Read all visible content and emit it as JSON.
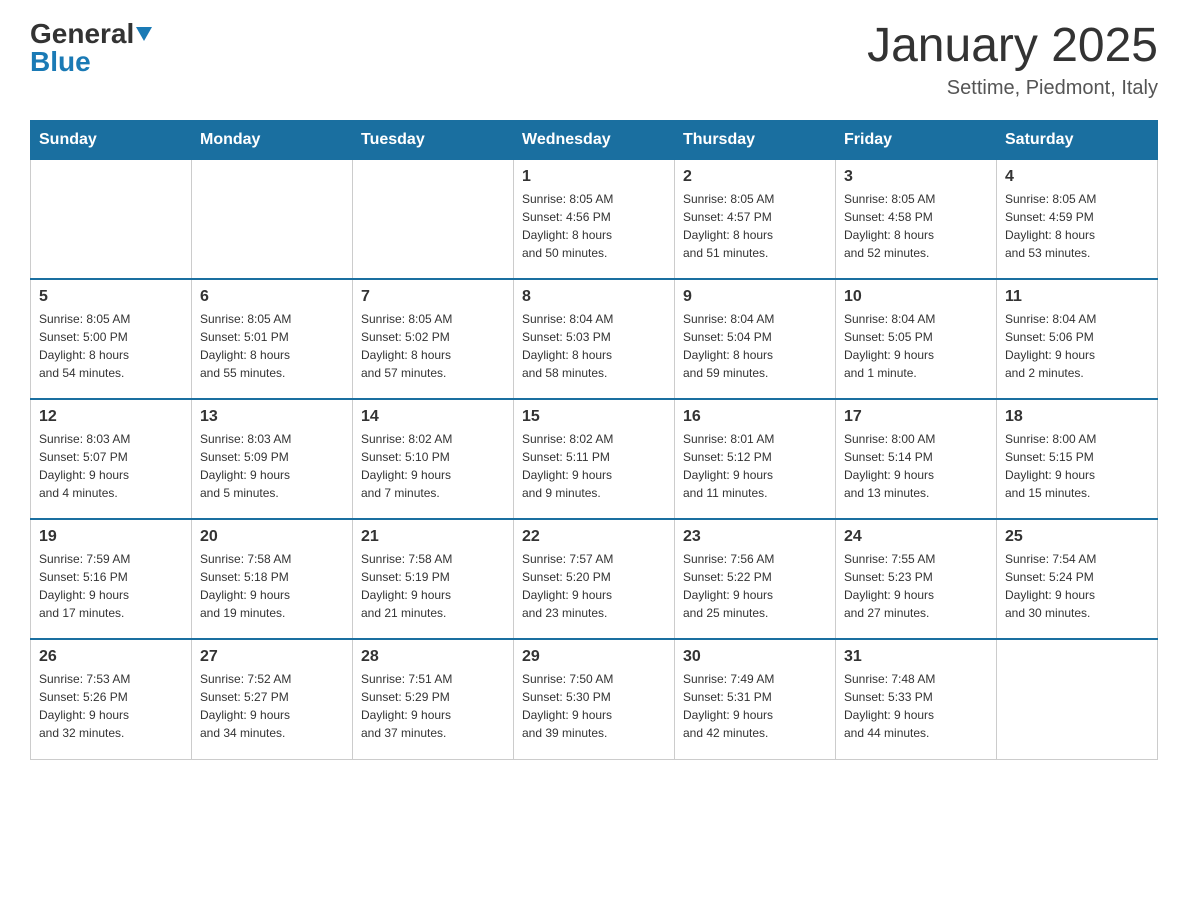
{
  "logo": {
    "general": "General",
    "blue": "Blue"
  },
  "title": "January 2025",
  "subtitle": "Settime, Piedmont, Italy",
  "weekdays": [
    "Sunday",
    "Monday",
    "Tuesday",
    "Wednesday",
    "Thursday",
    "Friday",
    "Saturday"
  ],
  "weeks": [
    [
      {
        "day": "",
        "info": ""
      },
      {
        "day": "",
        "info": ""
      },
      {
        "day": "",
        "info": ""
      },
      {
        "day": "1",
        "info": "Sunrise: 8:05 AM\nSunset: 4:56 PM\nDaylight: 8 hours\nand 50 minutes."
      },
      {
        "day": "2",
        "info": "Sunrise: 8:05 AM\nSunset: 4:57 PM\nDaylight: 8 hours\nand 51 minutes."
      },
      {
        "day": "3",
        "info": "Sunrise: 8:05 AM\nSunset: 4:58 PM\nDaylight: 8 hours\nand 52 minutes."
      },
      {
        "day": "4",
        "info": "Sunrise: 8:05 AM\nSunset: 4:59 PM\nDaylight: 8 hours\nand 53 minutes."
      }
    ],
    [
      {
        "day": "5",
        "info": "Sunrise: 8:05 AM\nSunset: 5:00 PM\nDaylight: 8 hours\nand 54 minutes."
      },
      {
        "day": "6",
        "info": "Sunrise: 8:05 AM\nSunset: 5:01 PM\nDaylight: 8 hours\nand 55 minutes."
      },
      {
        "day": "7",
        "info": "Sunrise: 8:05 AM\nSunset: 5:02 PM\nDaylight: 8 hours\nand 57 minutes."
      },
      {
        "day": "8",
        "info": "Sunrise: 8:04 AM\nSunset: 5:03 PM\nDaylight: 8 hours\nand 58 minutes."
      },
      {
        "day": "9",
        "info": "Sunrise: 8:04 AM\nSunset: 5:04 PM\nDaylight: 8 hours\nand 59 minutes."
      },
      {
        "day": "10",
        "info": "Sunrise: 8:04 AM\nSunset: 5:05 PM\nDaylight: 9 hours\nand 1 minute."
      },
      {
        "day": "11",
        "info": "Sunrise: 8:04 AM\nSunset: 5:06 PM\nDaylight: 9 hours\nand 2 minutes."
      }
    ],
    [
      {
        "day": "12",
        "info": "Sunrise: 8:03 AM\nSunset: 5:07 PM\nDaylight: 9 hours\nand 4 minutes."
      },
      {
        "day": "13",
        "info": "Sunrise: 8:03 AM\nSunset: 5:09 PM\nDaylight: 9 hours\nand 5 minutes."
      },
      {
        "day": "14",
        "info": "Sunrise: 8:02 AM\nSunset: 5:10 PM\nDaylight: 9 hours\nand 7 minutes."
      },
      {
        "day": "15",
        "info": "Sunrise: 8:02 AM\nSunset: 5:11 PM\nDaylight: 9 hours\nand 9 minutes."
      },
      {
        "day": "16",
        "info": "Sunrise: 8:01 AM\nSunset: 5:12 PM\nDaylight: 9 hours\nand 11 minutes."
      },
      {
        "day": "17",
        "info": "Sunrise: 8:00 AM\nSunset: 5:14 PM\nDaylight: 9 hours\nand 13 minutes."
      },
      {
        "day": "18",
        "info": "Sunrise: 8:00 AM\nSunset: 5:15 PM\nDaylight: 9 hours\nand 15 minutes."
      }
    ],
    [
      {
        "day": "19",
        "info": "Sunrise: 7:59 AM\nSunset: 5:16 PM\nDaylight: 9 hours\nand 17 minutes."
      },
      {
        "day": "20",
        "info": "Sunrise: 7:58 AM\nSunset: 5:18 PM\nDaylight: 9 hours\nand 19 minutes."
      },
      {
        "day": "21",
        "info": "Sunrise: 7:58 AM\nSunset: 5:19 PM\nDaylight: 9 hours\nand 21 minutes."
      },
      {
        "day": "22",
        "info": "Sunrise: 7:57 AM\nSunset: 5:20 PM\nDaylight: 9 hours\nand 23 minutes."
      },
      {
        "day": "23",
        "info": "Sunrise: 7:56 AM\nSunset: 5:22 PM\nDaylight: 9 hours\nand 25 minutes."
      },
      {
        "day": "24",
        "info": "Sunrise: 7:55 AM\nSunset: 5:23 PM\nDaylight: 9 hours\nand 27 minutes."
      },
      {
        "day": "25",
        "info": "Sunrise: 7:54 AM\nSunset: 5:24 PM\nDaylight: 9 hours\nand 30 minutes."
      }
    ],
    [
      {
        "day": "26",
        "info": "Sunrise: 7:53 AM\nSunset: 5:26 PM\nDaylight: 9 hours\nand 32 minutes."
      },
      {
        "day": "27",
        "info": "Sunrise: 7:52 AM\nSunset: 5:27 PM\nDaylight: 9 hours\nand 34 minutes."
      },
      {
        "day": "28",
        "info": "Sunrise: 7:51 AM\nSunset: 5:29 PM\nDaylight: 9 hours\nand 37 minutes."
      },
      {
        "day": "29",
        "info": "Sunrise: 7:50 AM\nSunset: 5:30 PM\nDaylight: 9 hours\nand 39 minutes."
      },
      {
        "day": "30",
        "info": "Sunrise: 7:49 AM\nSunset: 5:31 PM\nDaylight: 9 hours\nand 42 minutes."
      },
      {
        "day": "31",
        "info": "Sunrise: 7:48 AM\nSunset: 5:33 PM\nDaylight: 9 hours\nand 44 minutes."
      },
      {
        "day": "",
        "info": ""
      }
    ]
  ]
}
